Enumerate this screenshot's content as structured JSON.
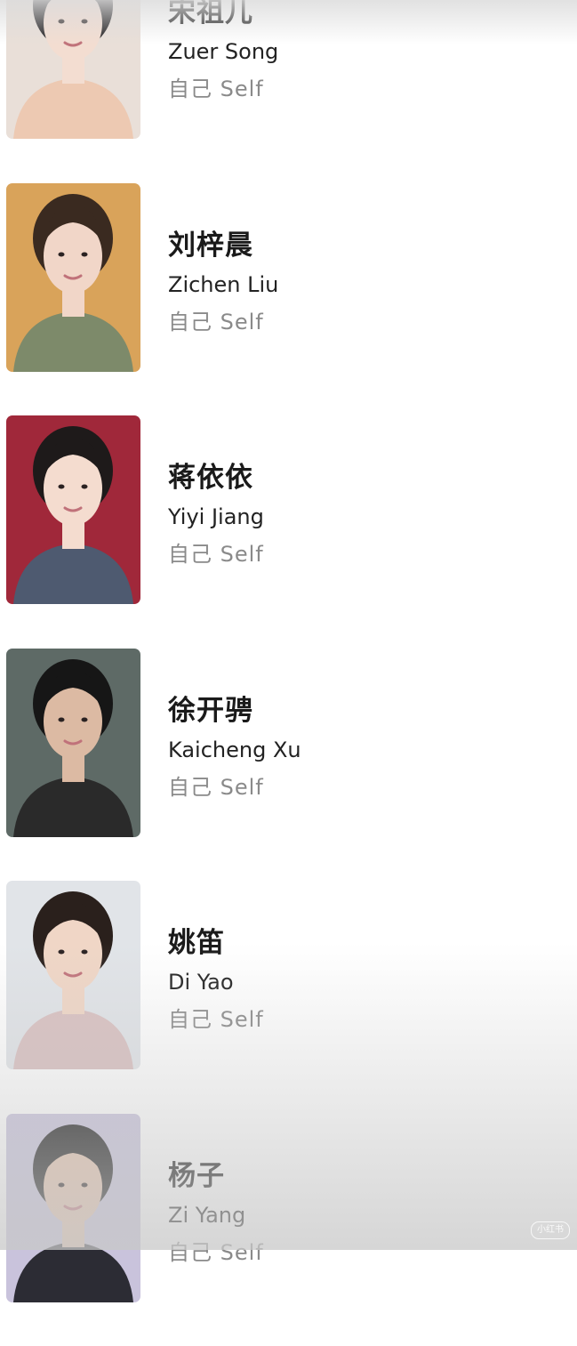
{
  "cast": [
    {
      "name_zh": "宋祖儿",
      "name_en": "Zuer Song",
      "role": "自己 Self",
      "photo_bg": "#e9dfd8",
      "hair": "#1c1a1c",
      "skin": "#f3ddd1",
      "cloth": "#edc9b2"
    },
    {
      "name_zh": "刘梓晨",
      "name_en": "Zichen Liu",
      "role": "自己 Self",
      "photo_bg": "#d9a35a",
      "hair": "#3a2a20",
      "skin": "#f1d6c8",
      "cloth": "#7d8a6a"
    },
    {
      "name_zh": "蒋依依",
      "name_en": "Yiyi Jiang",
      "role": "自己 Self",
      "photo_bg": "#a0283a",
      "hair": "#1e1a1a",
      "skin": "#f4dccf",
      "cloth": "#4e5a70"
    },
    {
      "name_zh": "徐开骋",
      "name_en": "Kaicheng Xu",
      "role": "自己 Self",
      "photo_bg": "#5e6a66",
      "hair": "#161616",
      "skin": "#dcbaa3",
      "cloth": "#2a2a2a"
    },
    {
      "name_zh": "姚笛",
      "name_en": "Di Yao",
      "role": "自己 Self",
      "photo_bg": "#e1e4e8",
      "hair": "#2a201c",
      "skin": "#f0d6c6",
      "cloth": "#d9c0c0"
    },
    {
      "name_zh": "杨子",
      "name_en": "Zi Yang",
      "role": "自己 Self",
      "photo_bg": "#c9c3dc",
      "hair": "#1b1b1b",
      "skin": "#e6c4ad",
      "cloth": "#2c2c34"
    }
  ],
  "watermark": {
    "text": "小红书"
  }
}
